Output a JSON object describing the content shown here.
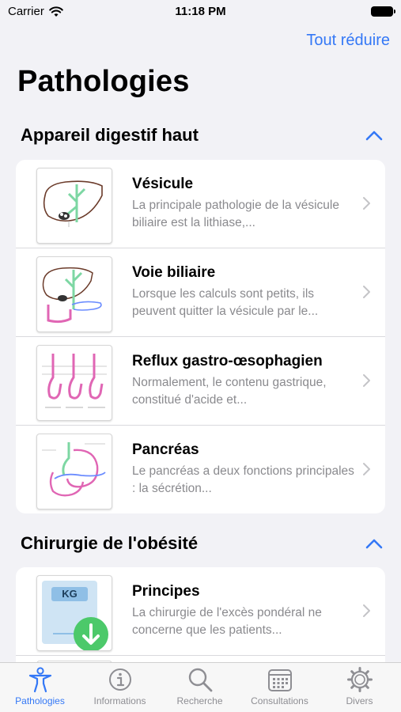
{
  "status_bar": {
    "carrier": "Carrier",
    "time": "11:18 PM"
  },
  "header": {
    "collapse_all": "Tout réduire",
    "title": "Pathologies"
  },
  "sections": [
    {
      "title": "Appareil digestif haut",
      "items": [
        {
          "title": "Vésicule",
          "description": "La principale pathologie de la vésicule biliaire est la lithiase,..."
        },
        {
          "title": "Voie biliaire",
          "description": "Lorsque les calculs sont petits, ils peuvent quitter la vésicule par le..."
        },
        {
          "title": "Reflux gastro-œsophagien",
          "description": "Normalement, le contenu gastrique, constitué d'acide et..."
        },
        {
          "title": "Pancréas",
          "description": "Le pancréas a deux fonctions principales : la sécrétion..."
        }
      ]
    },
    {
      "title": "Chirurgie de l'obésité",
      "items": [
        {
          "title": "Principes",
          "description": "La chirurgie de l'excès pondéral ne concerne que les patients...",
          "thumb_text": "KG"
        }
      ]
    }
  ],
  "tabs": [
    {
      "label": "Pathologies",
      "icon": "person-icon",
      "active": true
    },
    {
      "label": "Informations",
      "icon": "info-icon"
    },
    {
      "label": "Recherche",
      "icon": "search-icon"
    },
    {
      "label": "Consultations",
      "icon": "calendar-icon"
    },
    {
      "label": "Divers",
      "icon": "gear-icon"
    }
  ],
  "colors": {
    "accent": "#3478f6",
    "background": "#f2f2f6",
    "secondary_text": "#8a8a8e"
  }
}
